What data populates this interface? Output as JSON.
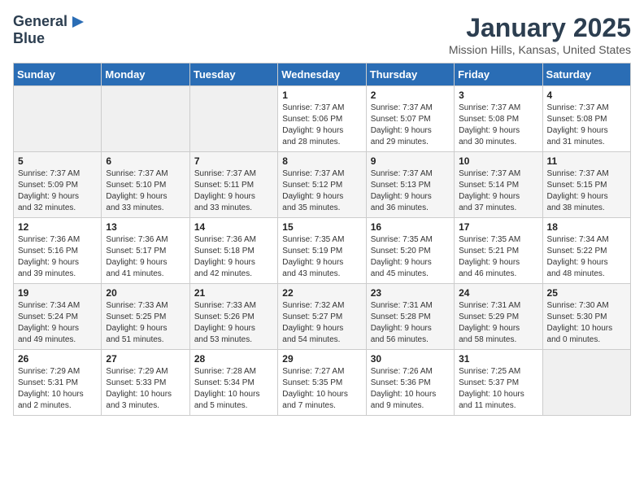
{
  "header": {
    "logo_general": "General",
    "logo_blue": "Blue",
    "month": "January 2025",
    "location": "Mission Hills, Kansas, United States"
  },
  "weekdays": [
    "Sunday",
    "Monday",
    "Tuesday",
    "Wednesday",
    "Thursday",
    "Friday",
    "Saturday"
  ],
  "weeks": [
    [
      {
        "day": "",
        "content": ""
      },
      {
        "day": "",
        "content": ""
      },
      {
        "day": "",
        "content": ""
      },
      {
        "day": "1",
        "content": "Sunrise: 7:37 AM\nSunset: 5:06 PM\nDaylight: 9 hours\nand 28 minutes."
      },
      {
        "day": "2",
        "content": "Sunrise: 7:37 AM\nSunset: 5:07 PM\nDaylight: 9 hours\nand 29 minutes."
      },
      {
        "day": "3",
        "content": "Sunrise: 7:37 AM\nSunset: 5:08 PM\nDaylight: 9 hours\nand 30 minutes."
      },
      {
        "day": "4",
        "content": "Sunrise: 7:37 AM\nSunset: 5:08 PM\nDaylight: 9 hours\nand 31 minutes."
      }
    ],
    [
      {
        "day": "5",
        "content": "Sunrise: 7:37 AM\nSunset: 5:09 PM\nDaylight: 9 hours\nand 32 minutes."
      },
      {
        "day": "6",
        "content": "Sunrise: 7:37 AM\nSunset: 5:10 PM\nDaylight: 9 hours\nand 33 minutes."
      },
      {
        "day": "7",
        "content": "Sunrise: 7:37 AM\nSunset: 5:11 PM\nDaylight: 9 hours\nand 33 minutes."
      },
      {
        "day": "8",
        "content": "Sunrise: 7:37 AM\nSunset: 5:12 PM\nDaylight: 9 hours\nand 35 minutes."
      },
      {
        "day": "9",
        "content": "Sunrise: 7:37 AM\nSunset: 5:13 PM\nDaylight: 9 hours\nand 36 minutes."
      },
      {
        "day": "10",
        "content": "Sunrise: 7:37 AM\nSunset: 5:14 PM\nDaylight: 9 hours\nand 37 minutes."
      },
      {
        "day": "11",
        "content": "Sunrise: 7:37 AM\nSunset: 5:15 PM\nDaylight: 9 hours\nand 38 minutes."
      }
    ],
    [
      {
        "day": "12",
        "content": "Sunrise: 7:36 AM\nSunset: 5:16 PM\nDaylight: 9 hours\nand 39 minutes."
      },
      {
        "day": "13",
        "content": "Sunrise: 7:36 AM\nSunset: 5:17 PM\nDaylight: 9 hours\nand 41 minutes."
      },
      {
        "day": "14",
        "content": "Sunrise: 7:36 AM\nSunset: 5:18 PM\nDaylight: 9 hours\nand 42 minutes."
      },
      {
        "day": "15",
        "content": "Sunrise: 7:35 AM\nSunset: 5:19 PM\nDaylight: 9 hours\nand 43 minutes."
      },
      {
        "day": "16",
        "content": "Sunrise: 7:35 AM\nSunset: 5:20 PM\nDaylight: 9 hours\nand 45 minutes."
      },
      {
        "day": "17",
        "content": "Sunrise: 7:35 AM\nSunset: 5:21 PM\nDaylight: 9 hours\nand 46 minutes."
      },
      {
        "day": "18",
        "content": "Sunrise: 7:34 AM\nSunset: 5:22 PM\nDaylight: 9 hours\nand 48 minutes."
      }
    ],
    [
      {
        "day": "19",
        "content": "Sunrise: 7:34 AM\nSunset: 5:24 PM\nDaylight: 9 hours\nand 49 minutes."
      },
      {
        "day": "20",
        "content": "Sunrise: 7:33 AM\nSunset: 5:25 PM\nDaylight: 9 hours\nand 51 minutes."
      },
      {
        "day": "21",
        "content": "Sunrise: 7:33 AM\nSunset: 5:26 PM\nDaylight: 9 hours\nand 53 minutes."
      },
      {
        "day": "22",
        "content": "Sunrise: 7:32 AM\nSunset: 5:27 PM\nDaylight: 9 hours\nand 54 minutes."
      },
      {
        "day": "23",
        "content": "Sunrise: 7:31 AM\nSunset: 5:28 PM\nDaylight: 9 hours\nand 56 minutes."
      },
      {
        "day": "24",
        "content": "Sunrise: 7:31 AM\nSunset: 5:29 PM\nDaylight: 9 hours\nand 58 minutes."
      },
      {
        "day": "25",
        "content": "Sunrise: 7:30 AM\nSunset: 5:30 PM\nDaylight: 10 hours\nand 0 minutes."
      }
    ],
    [
      {
        "day": "26",
        "content": "Sunrise: 7:29 AM\nSunset: 5:31 PM\nDaylight: 10 hours\nand 2 minutes."
      },
      {
        "day": "27",
        "content": "Sunrise: 7:29 AM\nSunset: 5:33 PM\nDaylight: 10 hours\nand 3 minutes."
      },
      {
        "day": "28",
        "content": "Sunrise: 7:28 AM\nSunset: 5:34 PM\nDaylight: 10 hours\nand 5 minutes."
      },
      {
        "day": "29",
        "content": "Sunrise: 7:27 AM\nSunset: 5:35 PM\nDaylight: 10 hours\nand 7 minutes."
      },
      {
        "day": "30",
        "content": "Sunrise: 7:26 AM\nSunset: 5:36 PM\nDaylight: 10 hours\nand 9 minutes."
      },
      {
        "day": "31",
        "content": "Sunrise: 7:25 AM\nSunset: 5:37 PM\nDaylight: 10 hours\nand 11 minutes."
      },
      {
        "day": "",
        "content": ""
      }
    ]
  ]
}
